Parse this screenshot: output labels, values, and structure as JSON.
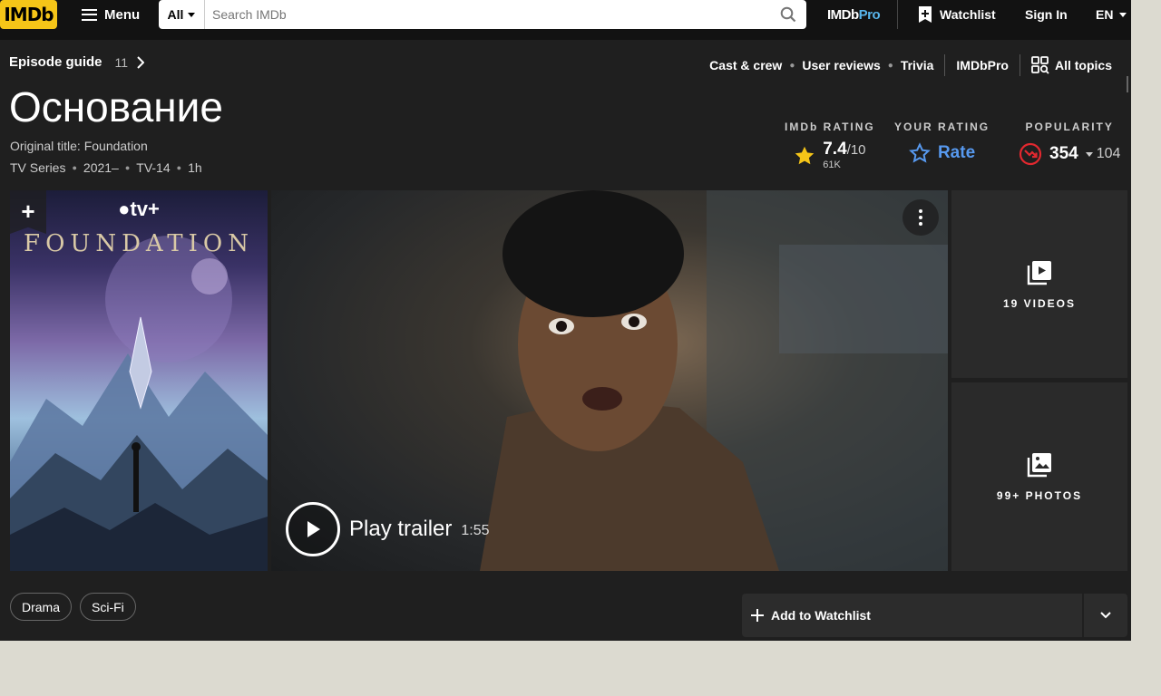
{
  "nav": {
    "logo": "IMDb",
    "menu_label": "Menu",
    "search_category": "All",
    "search_placeholder": "Search IMDb",
    "imdbpro_a": "IMDb",
    "imdbpro_b": "Pro",
    "watchlist_label": "Watchlist",
    "signin_label": "Sign In",
    "language": "EN"
  },
  "subnav": {
    "episode_guide": "Episode guide",
    "episode_count": "11",
    "links": [
      "Cast & crew",
      "User reviews",
      "Trivia"
    ],
    "imdbpro": "IMDbPro",
    "all_topics": "All topics"
  },
  "title": {
    "main": "Основание",
    "original": "Original title: Foundation",
    "meta": [
      "TV Series",
      "2021–",
      "TV-14",
      "1h"
    ]
  },
  "ratings": {
    "imdb_label": "IMDb RATING",
    "score": "7.4",
    "out_of": "/10",
    "votes": "61K",
    "your_label": "YOUR RATING",
    "rate_label": "Rate",
    "popularity_label": "POPULARITY",
    "popularity_rank": "354",
    "popularity_delta": "104"
  },
  "media": {
    "poster_brand": "tv+",
    "poster_title": "FOUNDATION",
    "play_label": "Play trailer",
    "duration": "1:55",
    "videos_label": "19 VIDEOS",
    "photos_label": "99+ PHOTOS"
  },
  "genres": [
    "Drama",
    "Sci-Fi"
  ],
  "actions": {
    "add_watchlist": "Add to Watchlist"
  },
  "colors": {
    "imdb_yellow": "#f5c518",
    "rate_blue": "#5799ef",
    "popularity_red": "#e2282f",
    "background": "#1f1f1f"
  }
}
